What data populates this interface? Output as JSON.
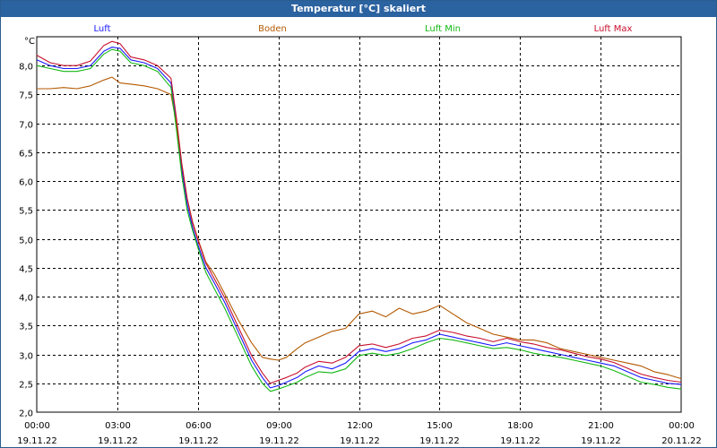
{
  "window": {
    "title": "Temperatur [°C] skaliert"
  },
  "chart_data": {
    "type": "line",
    "title": "Temperatur [°C] skaliert",
    "ylabel": "°C",
    "ylim": [
      2.0,
      8.5
    ],
    "xlim_hours": [
      0,
      24
    ],
    "grid": true,
    "legend_position": "top",
    "y_ticks": [
      "2,0",
      "2,5",
      "3,0",
      "3,5",
      "4,0",
      "4,5",
      "5,0",
      "5,5",
      "6,0",
      "6,5",
      "7,0",
      "7,5",
      "8,0"
    ],
    "x_ticks": [
      {
        "time": "00:00",
        "date": "19.11.22"
      },
      {
        "time": "03:00",
        "date": "19.11.22"
      },
      {
        "time": "06:00",
        "date": "19.11.22"
      },
      {
        "time": "09:00",
        "date": "19.11.22"
      },
      {
        "time": "12:00",
        "date": "19.11.22"
      },
      {
        "time": "15:00",
        "date": "19.11.22"
      },
      {
        "time": "18:00",
        "date": "19.11.22"
      },
      {
        "time": "21:00",
        "date": "19.11.22"
      },
      {
        "time": "00:00",
        "date": "20.11.22"
      }
    ],
    "series": [
      {
        "name": "Luft",
        "color": "#1a1aff",
        "x": [
          0,
          0.5,
          1,
          1.5,
          2,
          2.5,
          2.8,
          3.1,
          3.5,
          4,
          4.5,
          5,
          5.2,
          5.4,
          5.6,
          5.8,
          6,
          6.3,
          6.6,
          7,
          7.5,
          8,
          8.4,
          8.7,
          9,
          9.3,
          9.7,
          10,
          10.5,
          11,
          11.5,
          12,
          12.5,
          13,
          13.5,
          14,
          14.5,
          15,
          15.5,
          16,
          16.5,
          17,
          17.5,
          18,
          18.5,
          19,
          19.5,
          20,
          20.5,
          21,
          21.5,
          22,
          22.5,
          23,
          23.5,
          24
        ],
        "y": [
          8.1,
          8.0,
          7.95,
          7.95,
          8.0,
          8.25,
          8.32,
          8.3,
          8.1,
          8.05,
          7.95,
          7.7,
          7.0,
          6.2,
          5.6,
          5.2,
          4.9,
          4.5,
          4.25,
          3.9,
          3.4,
          2.9,
          2.6,
          2.42,
          2.46,
          2.52,
          2.6,
          2.7,
          2.8,
          2.75,
          2.85,
          3.05,
          3.1,
          3.05,
          3.1,
          3.2,
          3.25,
          3.35,
          3.3,
          3.25,
          3.2,
          3.15,
          3.2,
          3.15,
          3.1,
          3.05,
          3.0,
          2.95,
          2.9,
          2.85,
          2.8,
          2.7,
          2.6,
          2.55,
          2.5,
          2.48
        ]
      },
      {
        "name": "Boden",
        "color": "#b35900",
        "x": [
          0,
          0.5,
          1,
          1.5,
          2,
          2.5,
          2.8,
          3.1,
          3.5,
          4,
          4.5,
          5,
          5.2,
          5.4,
          5.6,
          5.8,
          6,
          6.3,
          6.6,
          7,
          7.5,
          8,
          8.4,
          8.7,
          9,
          9.3,
          9.7,
          10,
          10.5,
          11,
          11.5,
          12,
          12.5,
          13,
          13.5,
          14,
          14.5,
          15,
          15.5,
          16,
          16.5,
          17,
          17.5,
          18,
          18.5,
          19,
          19.5,
          20,
          20.5,
          21,
          21.5,
          22,
          22.5,
          23,
          23.5,
          24
        ],
        "y": [
          7.6,
          7.6,
          7.62,
          7.6,
          7.65,
          7.75,
          7.8,
          7.7,
          7.68,
          7.65,
          7.6,
          7.5,
          7.0,
          6.3,
          5.7,
          5.3,
          5.0,
          4.6,
          4.4,
          4.05,
          3.6,
          3.2,
          2.95,
          2.92,
          2.9,
          2.95,
          3.1,
          3.2,
          3.3,
          3.4,
          3.45,
          3.7,
          3.75,
          3.65,
          3.8,
          3.7,
          3.75,
          3.85,
          3.7,
          3.55,
          3.45,
          3.35,
          3.3,
          3.25,
          3.25,
          3.2,
          3.1,
          3.05,
          3.0,
          2.95,
          2.9,
          2.85,
          2.8,
          2.7,
          2.65,
          2.58
        ]
      },
      {
        "name": "Luft Min",
        "color": "#14b814",
        "x": [
          0,
          0.5,
          1,
          1.5,
          2,
          2.5,
          2.8,
          3.1,
          3.5,
          4,
          4.5,
          5,
          5.2,
          5.4,
          5.6,
          5.8,
          6,
          6.3,
          6.6,
          7,
          7.5,
          8,
          8.4,
          8.7,
          9,
          9.3,
          9.7,
          10,
          10.5,
          11,
          11.5,
          12,
          12.5,
          13,
          13.5,
          14,
          14.5,
          15,
          15.5,
          16,
          16.5,
          17,
          17.5,
          18,
          18.5,
          19,
          19.5,
          20,
          20.5,
          21,
          21.5,
          22,
          22.5,
          23,
          23.5,
          24
        ],
        "y": [
          8.0,
          7.95,
          7.9,
          7.9,
          7.95,
          8.2,
          8.28,
          8.25,
          8.05,
          8.0,
          7.9,
          7.62,
          6.9,
          6.1,
          5.5,
          5.15,
          4.85,
          4.42,
          4.15,
          3.8,
          3.3,
          2.8,
          2.5,
          2.36,
          2.4,
          2.45,
          2.52,
          2.6,
          2.7,
          2.68,
          2.75,
          2.98,
          3.02,
          2.98,
          3.02,
          3.1,
          3.2,
          3.28,
          3.25,
          3.2,
          3.15,
          3.1,
          3.12,
          3.08,
          3.02,
          2.98,
          2.95,
          2.9,
          2.85,
          2.8,
          2.72,
          2.62,
          2.52,
          2.48,
          2.43,
          2.4
        ]
      },
      {
        "name": "Luft Max",
        "color": "#c8102e",
        "x": [
          0,
          0.5,
          1,
          1.5,
          2,
          2.5,
          2.8,
          3.1,
          3.5,
          4,
          4.5,
          5,
          5.2,
          5.4,
          5.6,
          5.8,
          6,
          6.3,
          6.6,
          7,
          7.5,
          8,
          8.4,
          8.7,
          9,
          9.3,
          9.7,
          10,
          10.5,
          11,
          11.5,
          12,
          12.5,
          13,
          13.5,
          14,
          14.5,
          15,
          15.5,
          16,
          16.5,
          17,
          17.5,
          18,
          18.5,
          19,
          19.5,
          20,
          20.5,
          21,
          21.5,
          22,
          22.5,
          23,
          23.5,
          24
        ],
        "y": [
          8.18,
          8.05,
          8.0,
          8.0,
          8.08,
          8.35,
          8.42,
          8.38,
          8.15,
          8.1,
          8.0,
          7.78,
          7.1,
          6.3,
          5.7,
          5.28,
          4.98,
          4.58,
          4.32,
          3.98,
          3.48,
          2.98,
          2.68,
          2.5,
          2.55,
          2.6,
          2.68,
          2.78,
          2.88,
          2.85,
          2.95,
          3.15,
          3.18,
          3.12,
          3.18,
          3.28,
          3.32,
          3.42,
          3.38,
          3.32,
          3.28,
          3.22,
          3.28,
          3.22,
          3.18,
          3.12,
          3.08,
          3.02,
          2.96,
          2.92,
          2.86,
          2.76,
          2.66,
          2.6,
          2.55,
          2.52
        ]
      }
    ]
  }
}
